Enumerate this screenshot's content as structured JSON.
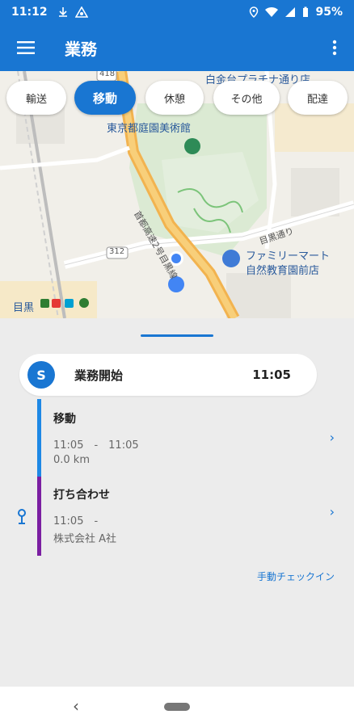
{
  "status_bar": {
    "time": "11:12",
    "battery": "95%",
    "icons": [
      "download-icon",
      "vpn-icon",
      "location-icon",
      "wifi-icon",
      "signal-icon",
      "battery-icon"
    ]
  },
  "app_bar": {
    "title": "業務",
    "menu_icon": "hamburger-icon",
    "overflow_icon": "more-vert-icon"
  },
  "activity_chips": [
    {
      "label": "輸送",
      "active": false
    },
    {
      "label": "移動",
      "active": true
    },
    {
      "label": "休憩",
      "active": false
    },
    {
      "label": "その他",
      "active": false
    },
    {
      "label": "配達",
      "active": false
    }
  ],
  "map": {
    "labels": {
      "park_hotel": "白金台プラチナ通り店",
      "museum": "東京都庭園美術館",
      "expressway": "首都高速2号目黒線",
      "meguro_street": "目黒通り",
      "route_number": "312",
      "route_top": "418",
      "familymart": "ファミリーマート",
      "familymart_branch": "自然教育園前店",
      "station": "目黒"
    }
  },
  "timeline": {
    "start": {
      "badge": "S",
      "label": "業務開始",
      "time": "11:05"
    },
    "items": [
      {
        "title": "移動",
        "line1": "11:05　-　11:05",
        "line2": "0.0 km",
        "color": "#1e88e5"
      },
      {
        "title": "打ち合わせ",
        "line1": "11:05　-",
        "line2": "株式会社 A社",
        "color": "#7b1fa2"
      }
    ],
    "manual_checkin": "手動チェックイン"
  },
  "colors": {
    "primary": "#1976d2",
    "move": "#1e88e5",
    "meeting": "#7b1fa2"
  }
}
